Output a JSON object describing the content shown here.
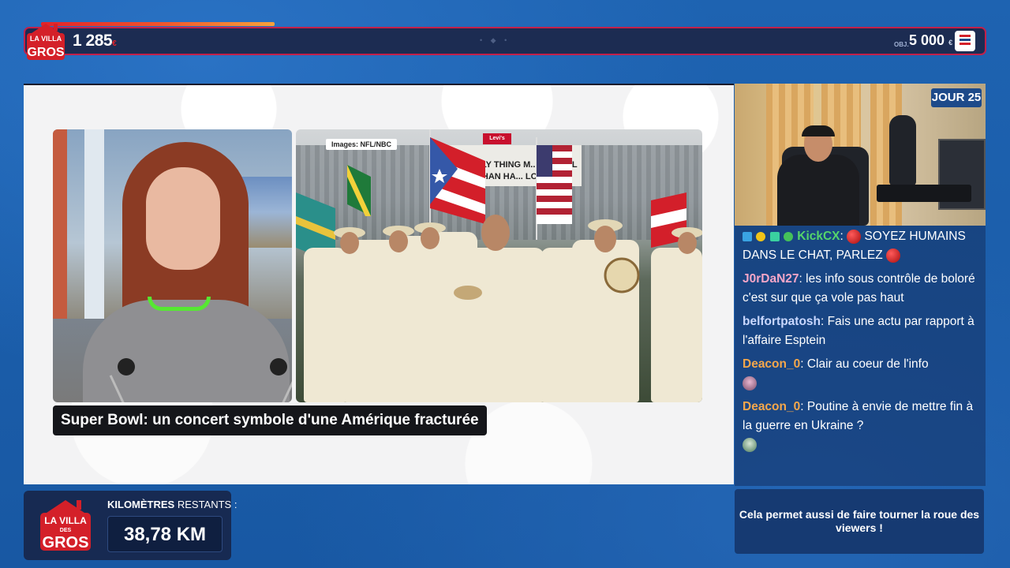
{
  "top_bar": {
    "count": "1 285",
    "count_unit": "€",
    "progress_fraction": 0.26,
    "goal_label": "OBJ.",
    "goal": "5 000",
    "goal_unit": "€"
  },
  "logo": {
    "line1": "LA VILLA",
    "line2": "DES",
    "line3": "GROS"
  },
  "video": {
    "credit": "Images: NFL/NBC",
    "banner_text": "THE ONLY THING M... WERFUL THAN HA... LOVE",
    "banner_logo": "Levi's",
    "caption": "Super Bowl: un concert symbole d'une Amérique fracturée"
  },
  "webcam": {
    "day_label": "JOUR 25"
  },
  "chat": {
    "messages": [
      {
        "user": "KickCX",
        "user_color": "#55d46a",
        "text": "SOYEZ HUMAINS DANS LE CHAT, PARLEZ",
        "badges": true,
        "emote_before": "red-ball-emote",
        "emote_after": "red-ball-emote"
      },
      {
        "user": "J0rDaN27",
        "user_color": "#f4a6c7",
        "text": "les info sous contrôle de boloré c'est sur que ça vole pas haut"
      },
      {
        "user": "belfortpatosh",
        "user_color": "#c9d8ff",
        "text": "Fais une actu par rapport à l'affaire Esptein"
      },
      {
        "user": "Deacon_0",
        "user_color": "#f4a74b",
        "text": "Clair au coeur de l'info",
        "emote_after": "face-emote"
      },
      {
        "user": "Deacon_0",
        "user_color": "#f4a74b",
        "text": "Poutine à envie de mettre fin à la guerre en Ukraine ?",
        "emote_after": "face-emote"
      }
    ]
  },
  "promo": {
    "text": "Cela permet aussi de faire tourner la roue des viewers !"
  },
  "km": {
    "label_bold": "KILOMÈTRES",
    "label_rest": " RESTANTS :",
    "value": "38,78 KM"
  },
  "colors": {
    "background": "#1b5fae",
    "accent_red": "#c3204a",
    "panel_dark": "#172a52",
    "collar_green": "#56e832"
  }
}
